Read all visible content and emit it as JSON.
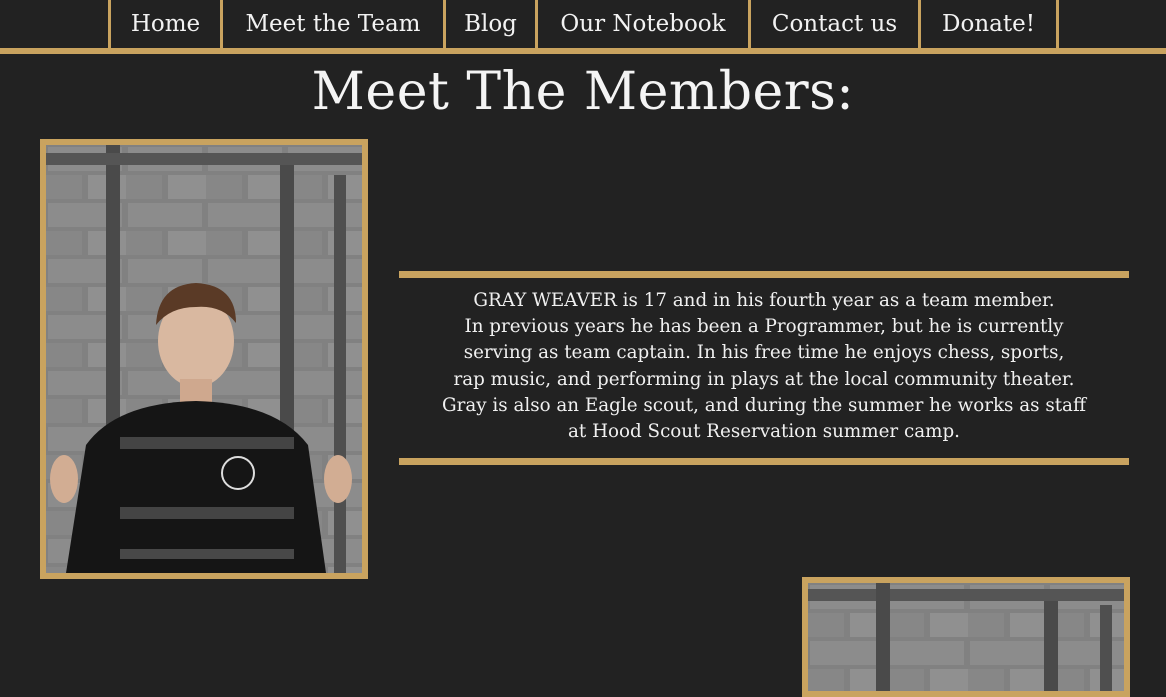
{
  "nav": {
    "items": [
      "Home",
      "Meet the Team",
      "Blog",
      "Our Notebook",
      "Contact us",
      "Donate!"
    ]
  },
  "page": {
    "title": "Meet The Members:"
  },
  "members": [
    {
      "photo_alt": "GRAY WEAVER",
      "bio": "GRAY WEAVER  is 17 and in his fourth year as a team member.\nIn previous years he has been a Programmer, but he is currently\nserving as team captain. In his free time he enjoys chess, sports,\nrap music, and performing in plays at the local community theater.\nGray is also an Eagle scout, and during the summer he works as staff\nat Hood Scout Reservation summer camp."
    }
  ],
  "colors": {
    "background": "#222222",
    "accent_gold": "#c9a35f",
    "text": "#f2f2f2"
  },
  "icons": {
    "member_photo": "member-photo-icon"
  }
}
